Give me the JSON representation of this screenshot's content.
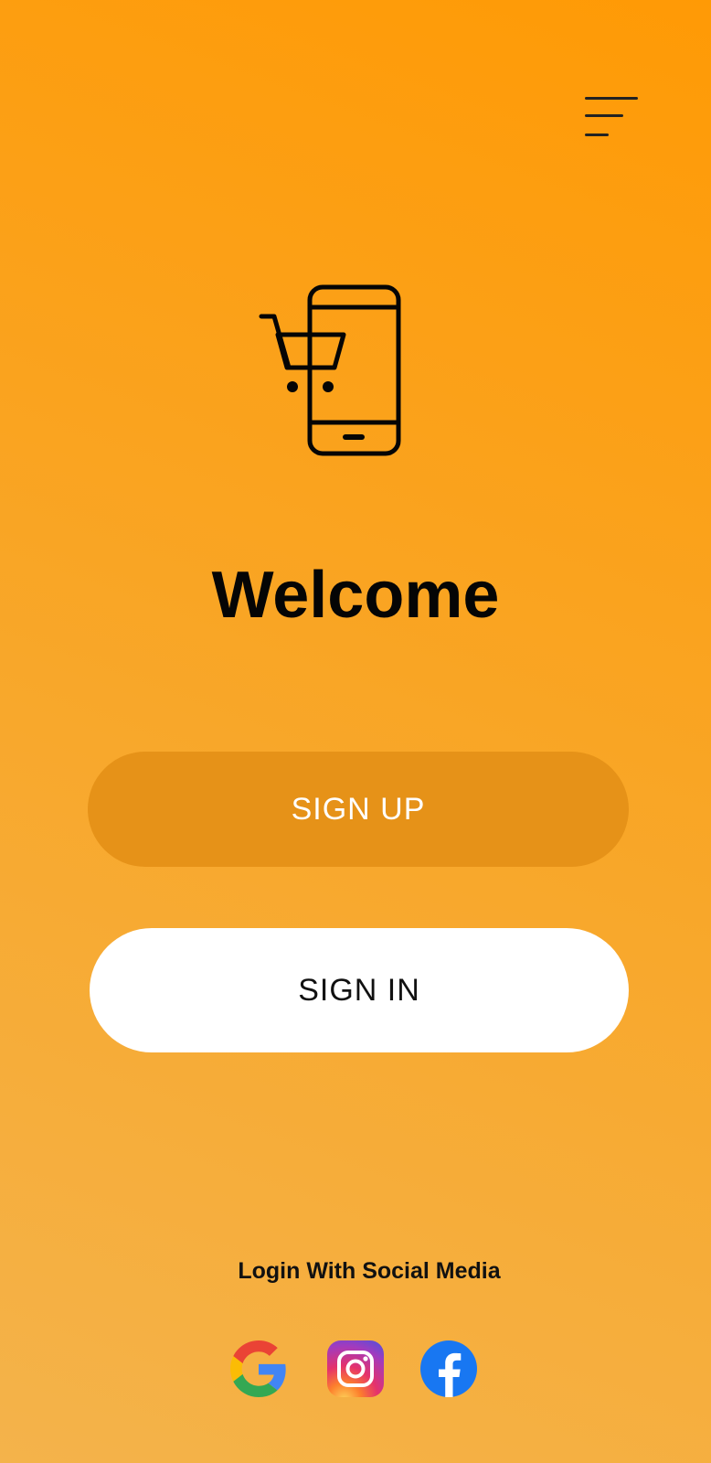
{
  "header": {
    "menu_icon": "hamburger-menu-icon"
  },
  "logo": {
    "icon": "mobile-shopping-cart-icon"
  },
  "main": {
    "title": "Welcome",
    "signup_label": "SIGN UP",
    "signin_label": "SIGN IN"
  },
  "social": {
    "label": "Login With Social Media",
    "providers": [
      {
        "name": "google",
        "icon": "google-icon"
      },
      {
        "name": "instagram",
        "icon": "instagram-icon"
      },
      {
        "name": "facebook",
        "icon": "facebook-icon"
      }
    ]
  },
  "colors": {
    "background_top": "#ff9a05",
    "background_bottom": "#f4b34b",
    "signup_button": "#e69218",
    "signin_button": "#ffffff",
    "text": "#050505"
  }
}
